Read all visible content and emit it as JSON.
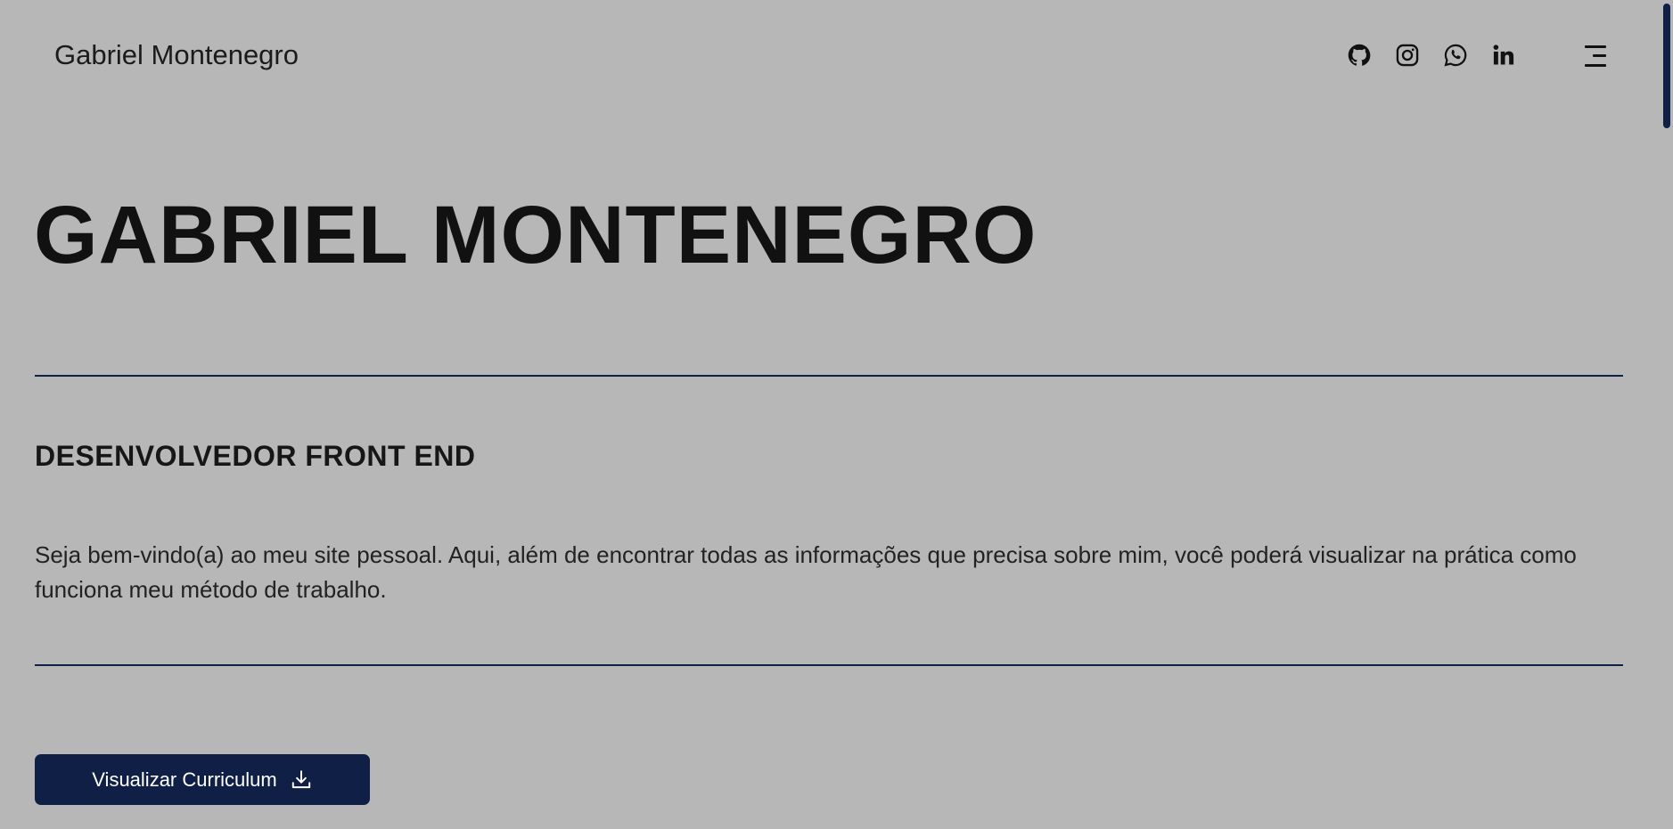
{
  "header": {
    "brand": "Gabriel Montenegro",
    "socials": [
      {
        "name": "github",
        "icon": "github-icon"
      },
      {
        "name": "instagram",
        "icon": "instagram-icon"
      },
      {
        "name": "whatsapp",
        "icon": "whatsapp-icon"
      },
      {
        "name": "linkedin",
        "icon": "linkedin-icon"
      }
    ],
    "menu_icon": "menu-icon"
  },
  "hero": {
    "title": "GABRIEL MONTENEGRO",
    "role": "DESENVOLVEDOR FRONT END",
    "intro": "Seja bem-vindo(a) ao meu site pessoal. Aqui, além de encontrar todas as informações que precisa sobre mim, você poderá visualizar na prática como funciona meu método de trabalho.",
    "cv_button_label": "Visualizar Curriculum",
    "cv_button_icon": "download-icon"
  },
  "colors": {
    "background": "#b7b7b7",
    "accent": "#0f1f45",
    "text": "#111111",
    "button_text": "#ffffff"
  }
}
